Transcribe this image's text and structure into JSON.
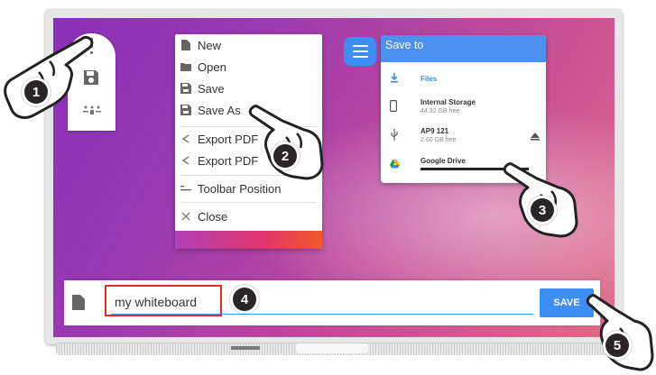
{
  "menu": {
    "items": [
      {
        "label": "New",
        "icon": "file-icon"
      },
      {
        "label": "Open",
        "icon": "folder-icon"
      },
      {
        "label": "Save",
        "icon": "floppy-icon"
      },
      {
        "label": "Save As",
        "icon": "floppy-icon"
      },
      {
        "label": "Export PDF",
        "icon": "share-icon"
      },
      {
        "label": "Export PDF",
        "icon": "share-icon"
      },
      {
        "label": "Toolbar Position",
        "icon": "toolbar-position-icon"
      },
      {
        "label": "Close",
        "icon": "close-icon"
      }
    ]
  },
  "save_to": {
    "title": "Save to",
    "locations": [
      {
        "name": "Files",
        "sub": "",
        "icon": "download-icon"
      },
      {
        "name": "Internal Storage",
        "sub": "44.32 GB free",
        "icon": "phone-icon"
      },
      {
        "name": "AP9 121",
        "sub": "2.60 GB free",
        "icon": "usb-icon",
        "eject": "eject-icon"
      },
      {
        "name": "Google Drive",
        "sub": "",
        "icon": "drive-icon"
      }
    ]
  },
  "bottom": {
    "filename_value": "my whiteboard",
    "save_label": "SAVE"
  },
  "steps": [
    "1",
    "2",
    "3",
    "4",
    "5"
  ],
  "colors": {
    "accent_blue": "#3d8ef2",
    "highlight_red": "#e32d2d",
    "badge_dark": "#2a2526"
  }
}
